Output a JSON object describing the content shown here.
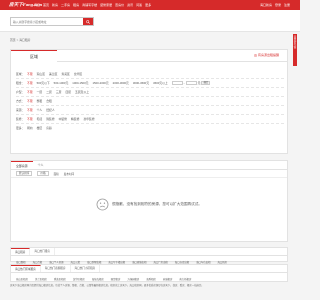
{
  "nav": {
    "logo": "房天下Fang.com",
    "items": [
      "首页",
      "新房",
      "二手房",
      "租房",
      "商铺写字楼",
      "装修家居",
      "查房价",
      "资讯",
      "问答",
      "更多"
    ],
    "city": "海口",
    "right_items": [
      "海口新房",
      "登录",
      "注册"
    ]
  },
  "search": {
    "placeholder": "输入关键字搜索小区或地址",
    "brand_color": "#d62a2a"
  },
  "breadcrumb": [
    "首页",
    ">",
    "海口租房"
  ],
  "side_ad": "意见反馈",
  "filter": {
    "tab": "区域",
    "subscribe": "有房源出租提醒",
    "rows": [
      {
        "label": "区域：",
        "options": [
          "不限",
          "琼山区",
          "美兰区",
          "秀英区",
          "龙华区"
        ]
      },
      {
        "label": "租金：",
        "options": [
          "不限",
          "500元以下",
          "500-1000元",
          "1000-1500元",
          "1500-2000元",
          "2000-3000元",
          "3000-4500元",
          "4500元以上"
        ]
      },
      {
        "label": "户型：",
        "options": [
          "不限",
          "一居",
          "二居",
          "三居",
          "四居",
          "五居及以上"
        ]
      },
      {
        "label": "方式：",
        "options": [
          "不限",
          "整租",
          "合租"
        ]
      },
      {
        "label": "来源：",
        "options": [
          "不限",
          "个人",
          "经纪人"
        ]
      },
      {
        "label": "装修：",
        "options": [
          "不限",
          "毛坯",
          "简装修",
          "中装修",
          "精装修",
          "豪华装修"
        ]
      },
      {
        "label": "更多：",
        "options": [
          "朝向",
          "楼层",
          "房龄"
        ]
      }
    ],
    "price_custom": {
      "sep": "-",
      "unit": "元",
      "button": "确定"
    },
    "more_label": "更多"
  },
  "results": {
    "tabs": [
      "全部房源",
      "个人"
    ],
    "sort": [
      "默认排序",
      "价格",
      "面积",
      "发布时间"
    ],
    "empty_message": "很抱歉，没有找到相符的房源，您可以扩大范围再试试。"
  },
  "link_blocks": [
    {
      "tabs": [
        "海口租房",
        "海口热门租房"
      ],
      "links": [
        "海口整租",
        "海口合租",
        "海口个人房源",
        "海口公寓",
        "海口别墅出租",
        "海口写字楼出租",
        "海口商铺出租",
        "海口厂房出租",
        "海口仓库出租",
        "海口车位出租",
        "海口新房"
      ]
    },
    {
      "tabs": [
        "海口热门区域租房",
        "海口热门商圈租房",
        "海口热门小区租房"
      ],
      "links": [
        "琼山区租房",
        "美兰区租房",
        "秀英区租房",
        "龙华区租房",
        "海甸岛租房",
        "国贸租房",
        "万绿园租房",
        "海秀租房",
        "府城租房",
        "南大桥租房"
      ]
    }
  ],
  "footer": "房天下海口租房网为您提供海口租房信息，包括个人房源、整租、合租、公寓等最新租房信息，租房就上房天下。海口租房网，更多优质房源尽在房天下，找房、看房、租房一站搞定。"
}
